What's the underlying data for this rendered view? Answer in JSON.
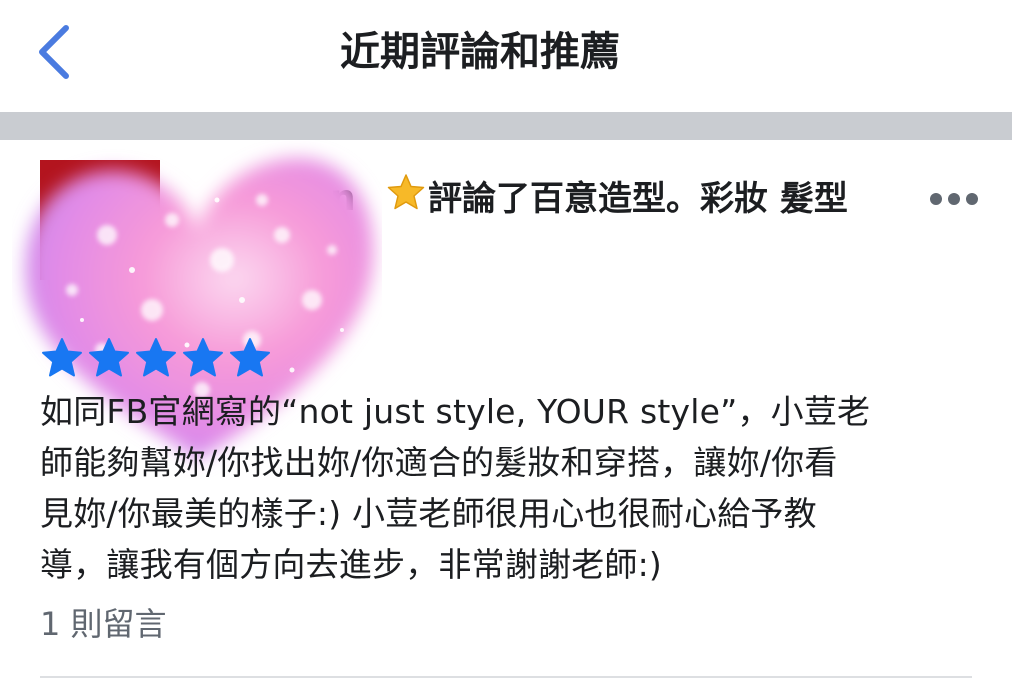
{
  "header": {
    "back_label": "Back",
    "title": "近期評論和推薦"
  },
  "review": {
    "author_name_visible": "n",
    "headline": "評論了百意造型。彩妝 髮型",
    "rating": 5,
    "rating_max": 5,
    "text_lines": [
      "如同FB官網寫的“not just style, YOUR style”，小荳老",
      "師能夠幫妳/你找出妳/你適合的髮妝和穿搭，讓妳/你看",
      "見妳/你最美的樣子:) 小荳老師很用心也很耐心給予教",
      "導，讓我有個方向去進步，非常謝謝老師:)"
    ],
    "comments_label": "1 則留言"
  },
  "colors": {
    "accent_blue": "#1877f2",
    "star_gold": "#f7b928",
    "divider_gray": "#c9ccd1",
    "secondary_text": "#606770",
    "avatar_red": "#b3141e"
  },
  "icons": {
    "back": "chevron-left-icon",
    "badge": "star-icon",
    "more": "more-horizontal-icon",
    "rating": "star-icon"
  }
}
